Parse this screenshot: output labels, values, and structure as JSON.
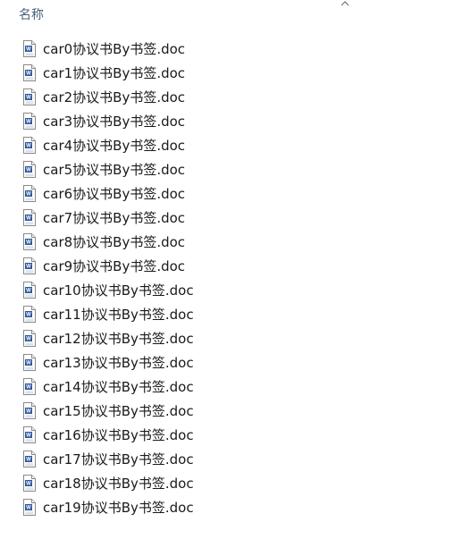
{
  "header": {
    "name_column_label": "名称",
    "sort_icon": "chevron-up-icon"
  },
  "files": [
    {
      "name": "car0协议书By书签.doc",
      "icon": "word-doc-icon"
    },
    {
      "name": "car1协议书By书签.doc",
      "icon": "word-doc-icon"
    },
    {
      "name": "car2协议书By书签.doc",
      "icon": "word-doc-icon"
    },
    {
      "name": "car3协议书By书签.doc",
      "icon": "word-doc-icon"
    },
    {
      "name": "car4协议书By书签.doc",
      "icon": "word-doc-icon"
    },
    {
      "name": "car5协议书By书签.doc",
      "icon": "word-doc-icon"
    },
    {
      "name": "car6协议书By书签.doc",
      "icon": "word-doc-icon"
    },
    {
      "name": "car7协议书By书签.doc",
      "icon": "word-doc-icon"
    },
    {
      "name": "car8协议书By书签.doc",
      "icon": "word-doc-icon"
    },
    {
      "name": "car9协议书By书签.doc",
      "icon": "word-doc-icon"
    },
    {
      "name": "car10协议书By书签.doc",
      "icon": "word-doc-icon"
    },
    {
      "name": "car11协议书By书签.doc",
      "icon": "word-doc-icon"
    },
    {
      "name": "car12协议书By书签.doc",
      "icon": "word-doc-icon"
    },
    {
      "name": "car13协议书By书签.doc",
      "icon": "word-doc-icon"
    },
    {
      "name": "car14协议书By书签.doc",
      "icon": "word-doc-icon"
    },
    {
      "name": "car15协议书By书签.doc",
      "icon": "word-doc-icon"
    },
    {
      "name": "car16协议书By书签.doc",
      "icon": "word-doc-icon"
    },
    {
      "name": "car17协议书By书签.doc",
      "icon": "word-doc-icon"
    },
    {
      "name": "car18协议书By书签.doc",
      "icon": "word-doc-icon"
    },
    {
      "name": "car19协议书By书签.doc",
      "icon": "word-doc-icon"
    }
  ]
}
